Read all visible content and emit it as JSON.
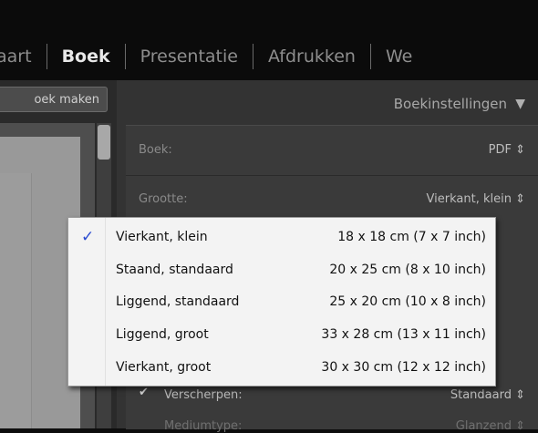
{
  "modules": [
    {
      "label": "aart",
      "active": false
    },
    {
      "label": "Boek",
      "active": true
    },
    {
      "label": "Presentatie",
      "active": false
    },
    {
      "label": "Afdrukken",
      "active": false
    },
    {
      "label": "We",
      "active": false
    }
  ],
  "left": {
    "create_book_button": "oek maken"
  },
  "panel": {
    "title": "Boekinstellingen",
    "collapse_icon": "triangle-down-icon",
    "rows": {
      "boek": {
        "label": "Boek:",
        "value": "PDF ⇕"
      },
      "grootte": {
        "label": "Grootte:",
        "value": "Vierkant, klein ⇕"
      },
      "verscherpen": {
        "label": "Verscherpen:",
        "value": "Standaard ⇕",
        "checked": true
      },
      "mediumtype": {
        "label": "Mediumtype:",
        "value": "Glanzend ⇕"
      }
    }
  },
  "dropdown": {
    "selected_index": 0,
    "items": [
      {
        "name": "Vierkant, klein",
        "size": "18 x 18 cm (7 x 7 inch)"
      },
      {
        "name": "Staand, standaard",
        "size": "20 x 25 cm (8 x 10 inch)"
      },
      {
        "name": "Liggend, standaard",
        "size": "25 x 20 cm (10 x 8 inch)"
      },
      {
        "name": "Liggend, groot",
        "size": "33 x 28 cm (13 x 11 inch)"
      },
      {
        "name": "Vierkant, groot",
        "size": "30 x 30 cm (12 x 12 inch)"
      }
    ]
  },
  "colors": {
    "accent_check": "#2a4ad0",
    "panel_bg": "#333333",
    "menu_bg": "#f3f3f3"
  }
}
